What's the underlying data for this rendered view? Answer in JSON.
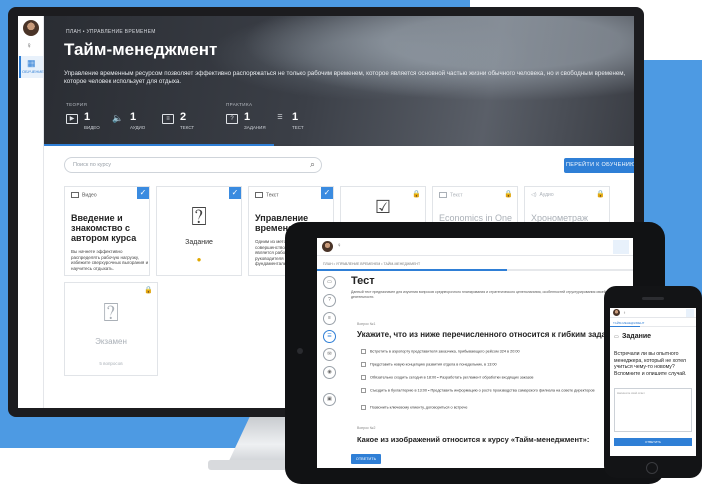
{
  "desktop": {
    "sidebar": {
      "nav_label": "ОБУЧЕНИЕ"
    },
    "hero": {
      "breadcrumb": "ПЛАН  •  УПРАВЛЕНИЕ ВРЕМЕНЕМ",
      "title": "Тайм-менеджмент",
      "description": "Управление временным ресурсом позволяет эффективно распоряжаться не только рабочим временем, которое является основной частью жизни обычного человека, но и свободным временем, которое человек использует для отдыха.",
      "theory_label": "ТЕОРИЯ",
      "practice_label": "ПРАКТИКА",
      "stats": [
        {
          "icon": "video-icon",
          "num": "1",
          "label": "ВИДЕО"
        },
        {
          "icon": "audio-icon",
          "num": "1",
          "label": "АУДИО"
        },
        {
          "icon": "text-icon",
          "num": "2",
          "label": "ТЕКСТ"
        },
        {
          "icon": "task-icon",
          "num": "1",
          "label": "ЗАДАНИЯ"
        },
        {
          "icon": "test-icon",
          "num": "1",
          "label": "ТЕСТ"
        }
      ]
    },
    "search": {
      "placeholder": "Поиск по курсу"
    },
    "go_button": "ПЕРЕЙТИ К ОБУЧЕНИЮ",
    "cards": {
      "video": {
        "type": "Видео",
        "title": "Введение и знакомство с автором курса",
        "desc": "Вы начнете эффективно распределять рабочую нагрузку, избежите сверхурочных выгорания и научитесь отдыхать."
      },
      "task": {
        "label": "Задание"
      },
      "text": {
        "type": "Текст",
        "title": "Управление временем",
        "desc": "Одним из методов совершенствования предприятия является рабочего времени руководителя предприятия и в руково фундаментальных"
      },
      "text2": {
        "type": "Текст",
        "title": "Economics in One Lesson"
      },
      "audio": {
        "type": "Аудио",
        "title": "Хронометраж"
      },
      "exam": {
        "label": "Экзамен",
        "sub": "5 вопросов"
      }
    }
  },
  "tablet": {
    "breadcrumb": "ПЛАН  •  УПРАВЛЕНИЕ ВРЕМЕНЕМ  •  ТАЙМ-МЕНЕДЖМЕНТ",
    "title": "Тест",
    "description": "Данный тест предназначен для изучения вопросов среднесрочного планирования и стратегического целеполагания, особенностей структурирования своей рабочей деятельности.",
    "q1_label": "Вопрос №1",
    "q1_title": "Укажите, что из ниже перечисленного относится к гибким задачам",
    "options": [
      "Встретить в аэропорту представителя заказчика, прибывающего рейсом 324 в 20:00",
      "Представить новую концепцию развития отдела в понедельник, в 13:00",
      "Обязательно сходить сегодня в 18:00 • Разработать регламент обработки входящих заказов",
      "Съездить в бухгалтерию в 13:00 • Представить информацию о росте производства самарского филиала на совете директоров",
      "Позвонить ключевому клиенту, договориться о встрече"
    ],
    "q2_label": "Вопрос №2",
    "q2_title": "Какое из изображений относится к курсу «Тайм-менеджмент»:",
    "submit": "ОТВЕТИТЬ"
  },
  "phone": {
    "back": "ТАЙМ-МЕНЕДЖМЕНТ",
    "title": "Задание",
    "text": "Встречали ли вы опытного менеджера, который не хотел учиться чему-то новому? Вспомните и опишите случай.",
    "placeholder": "Напишите свой ответ",
    "submit": "ОТВЕТИТЬ"
  },
  "colors": {
    "accent": "#2f7fd6",
    "background": "#4d9ae3"
  }
}
